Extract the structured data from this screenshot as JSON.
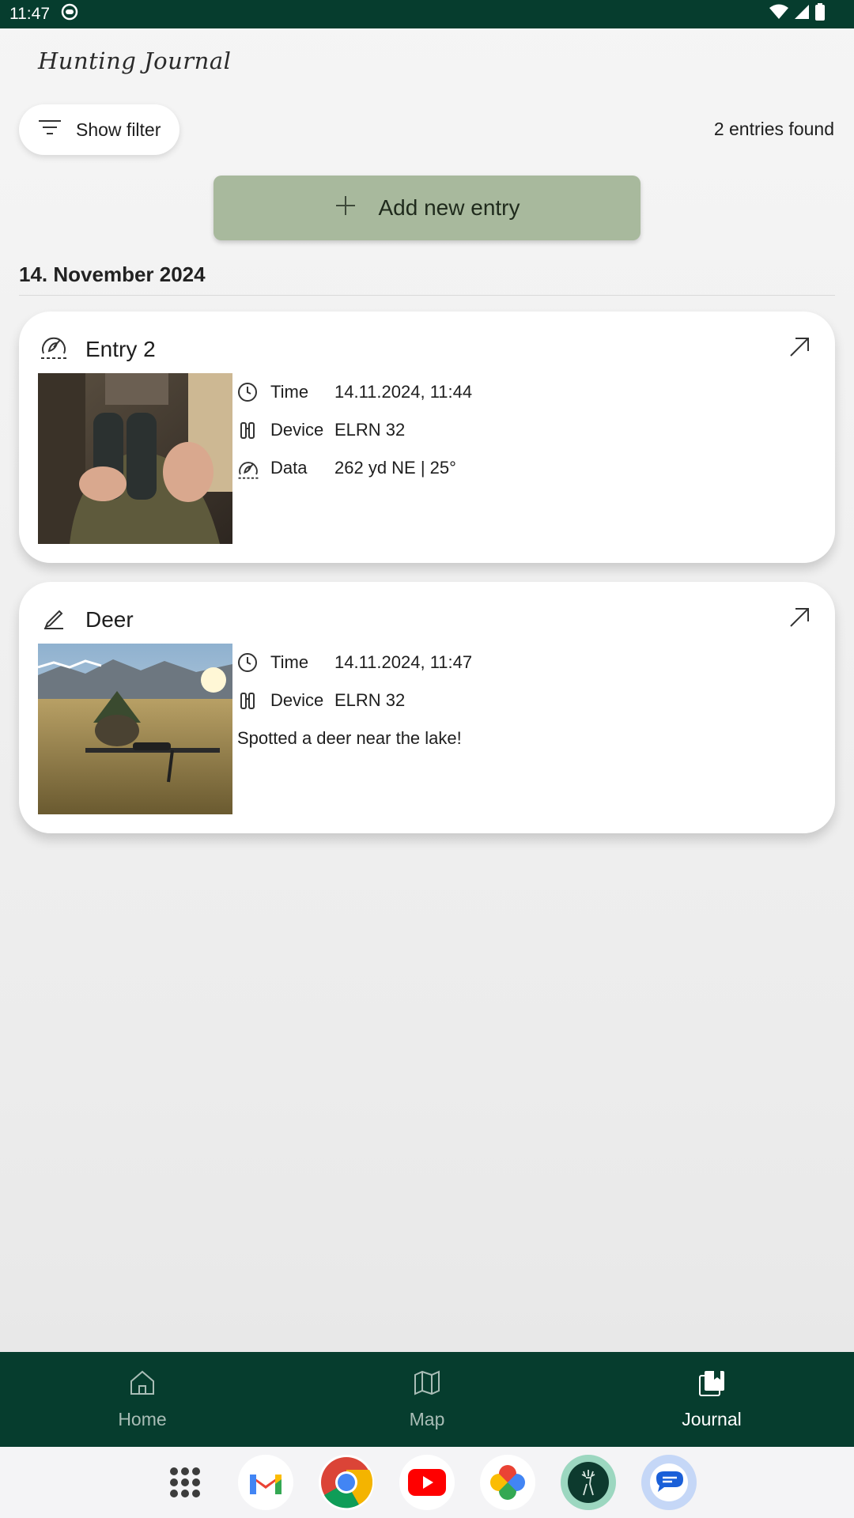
{
  "status_bar": {
    "time": "11:47"
  },
  "app": {
    "title": "Hunting Journal"
  },
  "toolbar": {
    "filter_label": "Show filter",
    "entries_found": "2 entries found"
  },
  "add_entry": {
    "label": "Add new entry"
  },
  "date_group": {
    "label": "14. November 2024"
  },
  "entries": [
    {
      "title": "Entry 2",
      "icon": "rangefinder-icon",
      "image": "hunter-with-binoculars",
      "details": [
        {
          "label": "Time",
          "value": "14.11.2024, 11:44",
          "icon": "clock-icon"
        },
        {
          "label": "Device",
          "value": "ELRN 32",
          "icon": "binoculars-icon"
        },
        {
          "label": "Data",
          "value": "262 yd NE | 25°",
          "icon": "rangefinder-icon"
        }
      ]
    },
    {
      "title": "Deer",
      "icon": "pencil-icon",
      "image": "rifle-in-grass-mountains",
      "details": [
        {
          "label": "Time",
          "value": "14.11.2024, 11:47",
          "icon": "clock-icon"
        },
        {
          "label": "Device",
          "value": "ELRN 32",
          "icon": "binoculars-icon"
        }
      ],
      "note": "Spotted a deer near the lake!"
    }
  ],
  "bottom_nav": [
    {
      "label": "Home",
      "icon": "home-icon",
      "active": false
    },
    {
      "label": "Map",
      "icon": "map-icon",
      "active": false
    },
    {
      "label": "Journal",
      "icon": "journal-icon",
      "active": true
    }
  ],
  "dock": [
    "app-drawer",
    "gmail",
    "chrome",
    "youtube",
    "photos",
    "hunting-app",
    "messages"
  ],
  "colors": {
    "primary": "#063d2e",
    "accent_button": "#a8b99d",
    "background": "#f5f5f5"
  }
}
